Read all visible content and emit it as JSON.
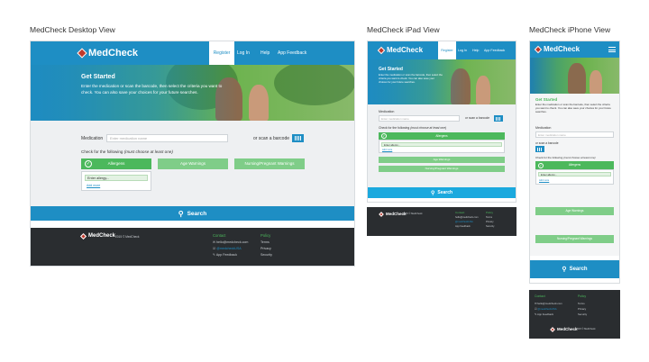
{
  "titles": {
    "desktop": "MedCheck Desktop View",
    "ipad": "MedCheck iPad View",
    "iphone": "MedCheck iPhone View"
  },
  "brand": "MedCheck",
  "copyright": "2015 © MedCheck",
  "nav": {
    "register": "Register",
    "login": "Log In",
    "help": "Help",
    "feedback": "App Feedback"
  },
  "hero": {
    "heading": "Get Started",
    "desktop_text": "Enter the medication or scan the barcode, then select the criteria you want to check. You can also save your choices for your future searches.",
    "mobile_text": "Enter the medication or scan the barcode, then select the criteria you want to check. You can also save your choices for your future searches."
  },
  "form": {
    "medication_label": "Medication",
    "medication_placeholder": "Enter medication name",
    "scan_label": "or scan a barcode",
    "check_label_prefix": "Check for the following ",
    "check_label_em": "(must choose at least one)",
    "allergies": "Allergens",
    "age_warnings": "Age Warnings",
    "nursing_warnings": "Nursing/Pregnant Warnings",
    "allergy_placeholder": "Enter allergy...",
    "add_more": "Add more"
  },
  "search": {
    "label": "Search"
  },
  "footer": {
    "contact_heading": "Contact",
    "policy_heading": "Policy",
    "contact_email": "hello@medcheck.com",
    "contact_twitter": "@medcheckUSA",
    "contact_feedback": "App Feedback",
    "policy_terms": "Terms",
    "policy_privacy": "Privacy",
    "policy_security": "Security"
  },
  "colors": {
    "primary_blue": "#1e8ec4",
    "green": "#4cb85c",
    "dark_footer": "#2a2d30",
    "body_gray": "#eef0f2"
  }
}
